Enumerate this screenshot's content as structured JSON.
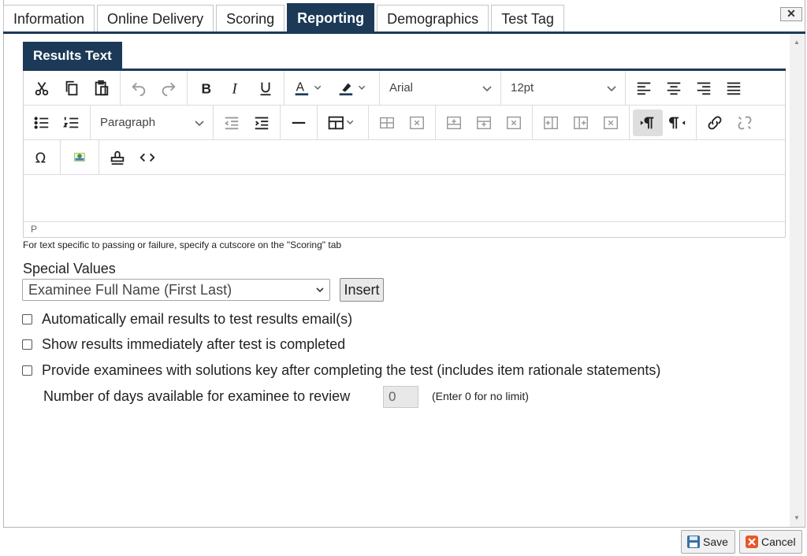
{
  "tabs": [
    "Information",
    "Online Delivery",
    "Scoring",
    "Reporting",
    "Demographics",
    "Test Tag"
  ],
  "active_tab": "Reporting",
  "close_label": "✕",
  "section_tab": "Results Text",
  "toolbar": {
    "font_family": "Arial",
    "font_size": "12pt",
    "block_format": "Paragraph"
  },
  "editor_status": "P",
  "hint_text": "For text specific to passing or failure, specify a cutscore on the \"Scoring\" tab",
  "special_values": {
    "label": "Special Values",
    "selected": "Examinee Full Name (First Last)",
    "insert_label": "Insert"
  },
  "options": {
    "auto_email": "Automatically email results to test results email(s)",
    "show_results": "Show results immediately after test is completed",
    "solutions_key": "Provide examinees with solutions key after completing the test (includes item rationale statements)"
  },
  "review_days": {
    "label": "Number of days available for examinee to review",
    "value": "0",
    "note": "(Enter 0 for no limit)"
  },
  "footer": {
    "save_label": "Save",
    "cancel_label": "Cancel"
  },
  "colors": {
    "accent": "#1c3a57",
    "save_icon": "#3a6ea5",
    "cancel_icon": "#e8562a"
  }
}
